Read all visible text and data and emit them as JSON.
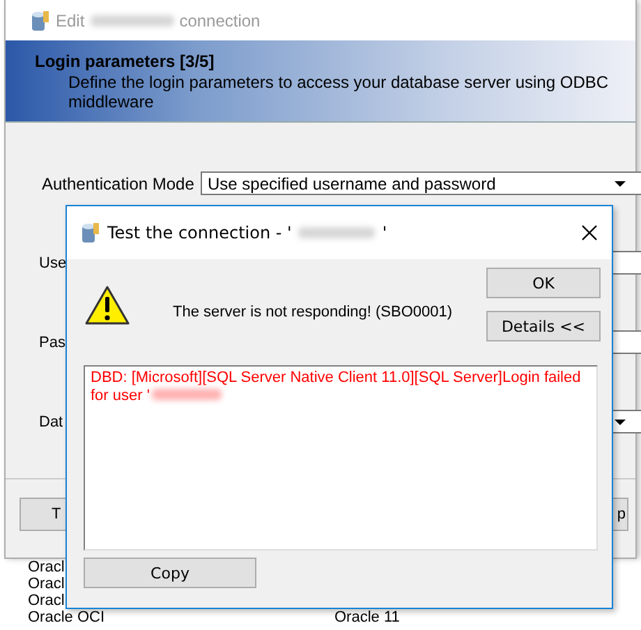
{
  "background_list": {
    "rows": [
      {
        "column_1": "Oracl"
      },
      {
        "column_1": "Oracl"
      },
      {
        "column_1": "Oracl"
      },
      {
        "column_1": "Oracle OCI",
        "column_2": "Oracle 11"
      }
    ]
  },
  "main_window": {
    "title_prefix": "Edit",
    "title_suffix": "connection",
    "step_title": "Login parameters [3/5]",
    "step_description": "Define the login parameters to access your database server using ODBC middleware",
    "fields": [
      {
        "label": "Authentication Mode",
        "kind": "combo",
        "value": "Use specified username and password"
      },
      {
        "label": "Use",
        "kind": "text"
      },
      {
        "label": "Pas",
        "kind": "text"
      },
      {
        "label": "Dat",
        "kind": "combo"
      }
    ],
    "buttons": [
      "T",
      "p"
    ]
  },
  "dialog": {
    "title_prefix": "Test the connection - '",
    "title_suffix": "'",
    "message": "The server is not responding! (SBO0001)",
    "buttons": [
      "OK",
      "Details <<"
    ],
    "details_text": "DBD: [Microsoft][SQL Server Native Client 11.0][SQL Server]Login failed for user '",
    "copy_button": "Copy"
  }
}
